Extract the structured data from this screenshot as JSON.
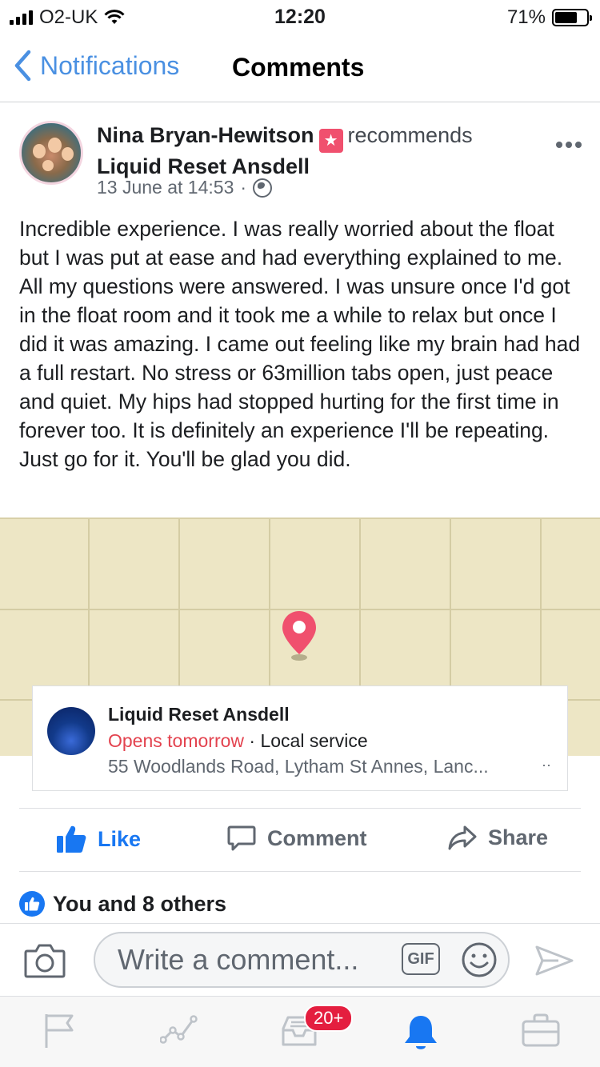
{
  "status_bar": {
    "carrier": "O2-UK",
    "time": "12:20",
    "battery": "71%",
    "battery_level": 0.71
  },
  "nav": {
    "back_label": "Notifications",
    "title": "Comments"
  },
  "post": {
    "author": "Nina Bryan-Hewitson",
    "action": "recommends",
    "page": "Liquid Reset Ansdell",
    "date": "13 June at 14:53",
    "dot": "·",
    "body": "Incredible experience. I was really worried about the float but I was put at ease and had everything explained to me. All my questions were answered. I was unsure once I'd got in the float room and it took me a while to relax but once I did it was amazing. I came out feeling like my brain had had a full restart. No stress or 63million tabs open, just peace and quiet. My hips had stopped hurting for the first time in forever too. It is definitely an experience I'll be repeating. Just go for it. You'll be glad you did."
  },
  "place": {
    "name": "Liquid Reset Ansdell",
    "status": "Opens tomorrow",
    "category": "· Local service",
    "address": "55 Woodlands Road, Lytham St Annes, Lanc...",
    "more": "··"
  },
  "actions": {
    "like": "Like",
    "comment": "Comment",
    "share": "Share"
  },
  "reactions": {
    "summary": "You and 8 others"
  },
  "composer": {
    "placeholder": "Write a comment...",
    "gif_label": "GIF"
  },
  "tab_bar": {
    "badge": "20+"
  },
  "colors": {
    "accent": "#1877f2",
    "ios_blue": "#4a90e2",
    "open_status": "#e3434f",
    "map_bg": "#ede6c5",
    "pin": "#f0506e",
    "badge": "#e41e3f"
  }
}
